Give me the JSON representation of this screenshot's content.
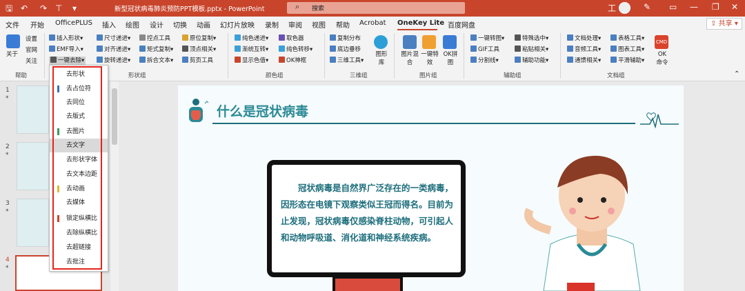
{
  "title_bar": {
    "document_title": "新型冠状病毒肺炎预防PPT模板.pptx  -  PowerPoint",
    "search_placeholder": "搜索",
    "user_initial": "工",
    "accent": "#c8452c"
  },
  "menu_tabs": [
    "文件",
    "开始",
    "OfficePLUS",
    "插入",
    "绘图",
    "设计",
    "切换",
    "动画",
    "幻灯片放映",
    "录制",
    "审阅",
    "视图",
    "帮助",
    "Acrobat",
    "OneKey Lite",
    "百度网盘"
  ],
  "active_tab": "OneKey Lite",
  "share_label": "共享",
  "ribbon": {
    "help_group": {
      "about": "关于",
      "settings": "设置",
      "official": "官网",
      "follow": "关注",
      "label": "帮助"
    },
    "shape_group": {
      "items": [
        "插入形状",
        "尺寸递进",
        "控点工具",
        "原位复制",
        "EMF导入",
        "对齐递进",
        "矩式复制",
        "顶点相关",
        "一键去除",
        "旋转递进",
        "拆合文本",
        "剪页工具"
      ],
      "label": "形状组"
    },
    "color_group": {
      "items": [
        "纯色递进",
        "取色器",
        "渐统互转",
        "纯色转移",
        "显示色值",
        "OK神框"
      ],
      "label": "颜色组"
    },
    "3d_group": {
      "items": [
        "复制分布",
        "底边垂移",
        "三维工具"
      ],
      "big": "图形库",
      "label": "三维组"
    },
    "image_group": {
      "items": [
        "图片混合",
        "一键特效",
        "OK拼图"
      ],
      "label": "图片组"
    },
    "assist_group": {
      "items": [
        "一键转图",
        "特殊选中",
        "GIF工具",
        "粘贴相关",
        "分割线",
        "辅助功能"
      ],
      "label": "辅助组"
    },
    "doc_group": {
      "items": [
        "文档处理",
        "表格工具",
        "音频工具",
        "图表工具",
        "通馈相关",
        "平滑辅助"
      ],
      "big": "OK命令",
      "cmd_badge": "CMD",
      "label": "文档组"
    }
  },
  "dropdown": {
    "items": [
      "去形状",
      "去占位符",
      "去同位",
      "去版式",
      "去图片",
      "去文字",
      "去形状字体",
      "去文本边距",
      "去动画",
      "去媒体",
      "锁定纵横比",
      "去除纵横比",
      "去超链接",
      "去批注"
    ],
    "highlighted": "去文字",
    "outline_color": "#e4231b"
  },
  "slides_panel": {
    "numbers": [
      "1",
      "2",
      "3",
      "4"
    ],
    "stars": [
      "*",
      "*",
      "*",
      "*"
    ],
    "active": "4"
  },
  "slide": {
    "title": "什么是冠状病毒",
    "body": "冠状病毒是自然界广泛存在的一类病毒，因形态在电镜下观察类似王冠而得名。目前为止发现，冠状病毒仅感染脊柱动物，可引起人和动物呼吸道、消化道和神经系统疾病。",
    "title_color": "#2a8a96"
  }
}
